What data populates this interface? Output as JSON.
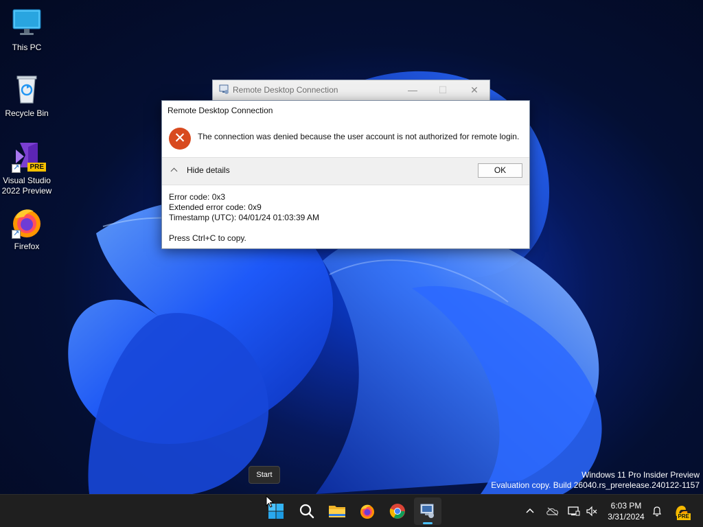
{
  "desktop": {
    "icons": [
      {
        "label": "This PC",
        "icon": "monitor-icon"
      },
      {
        "label": "Recycle Bin",
        "icon": "recycle-bin-icon"
      },
      {
        "label_line1": "Visual Studio",
        "label_line2": "2022 Preview",
        "icon": "visual-studio-icon",
        "badge": "PRE"
      },
      {
        "label": "Firefox",
        "icon": "firefox-icon"
      }
    ]
  },
  "background_window": {
    "title": "Remote Desktop Connection",
    "minimize": "—",
    "maximize": "☐",
    "close": "✕"
  },
  "dialog": {
    "title": "Remote Desktop Connection",
    "error_glyph": "✕",
    "message": "The connection was denied because the user account is not authorized for remote login.",
    "toggle_label": "Hide details",
    "ok_label": "OK",
    "details": {
      "error_code": "Error code: 0x3",
      "extended_error_code": "Extended error code: 0x9",
      "timestamp": "Timestamp (UTC): 04/01/24 01:03:39 AM",
      "copy_hint": "Press Ctrl+C to copy."
    }
  },
  "watermark": {
    "line1": "Windows 11 Pro Insider Preview",
    "line2": "Evaluation copy. Build 26040.rs_prerelease.240122-1157"
  },
  "tooltip": {
    "text": "Start"
  },
  "taskbar": {
    "buttons": [
      "start-icon",
      "search-icon",
      "file-explorer-icon",
      "firefox-icon",
      "chrome-icon",
      "remote-desktop-icon"
    ],
    "active": "remote-desktop-icon"
  },
  "tray": {
    "time": "6:03 PM",
    "date": "3/31/2024",
    "icons": [
      "chevron-up-icon",
      "onedrive-icon",
      "network-icon",
      "volume-muted-icon",
      "notification-bell-icon",
      "copilot-icon"
    ],
    "copilot_badge": "PRE"
  },
  "colors": {
    "taskbar": "#1f1f1f",
    "accent": "#4cc2ff",
    "error": "#d84a1f"
  }
}
